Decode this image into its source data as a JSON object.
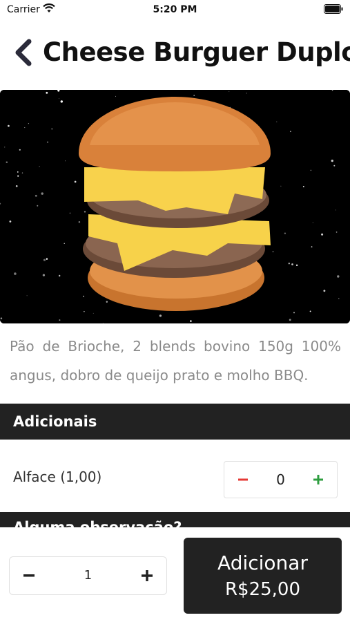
{
  "status_bar": {
    "carrier": "Carrier",
    "time": "5:20 PM",
    "icons": [
      "wifi-icon",
      "battery-icon"
    ]
  },
  "header": {
    "back_icon": "chevron-left-icon",
    "title": "Cheese Burguer Duplo"
  },
  "product": {
    "image": "cheeseburger-photo",
    "description": "Pão de Brioche, 2 blends bovino 150g 100% angus, dobro de queijo prato e molho BBQ."
  },
  "sections": {
    "adicionais": "Adicionais",
    "observacao": "Alguma observação?"
  },
  "addons": [
    {
      "label": "Alface (1,00)",
      "quantity": "0",
      "minus_icon": "minus-icon",
      "plus_icon": "plus-icon"
    }
  ],
  "bottom": {
    "quantity": "1",
    "add_label": "Adicionar",
    "add_price": "R$25,00"
  },
  "colors": {
    "dark": "#222222",
    "minus_red": "#e53935",
    "plus_green": "#2e9e3f",
    "description_gray": "#8a8a8a"
  }
}
